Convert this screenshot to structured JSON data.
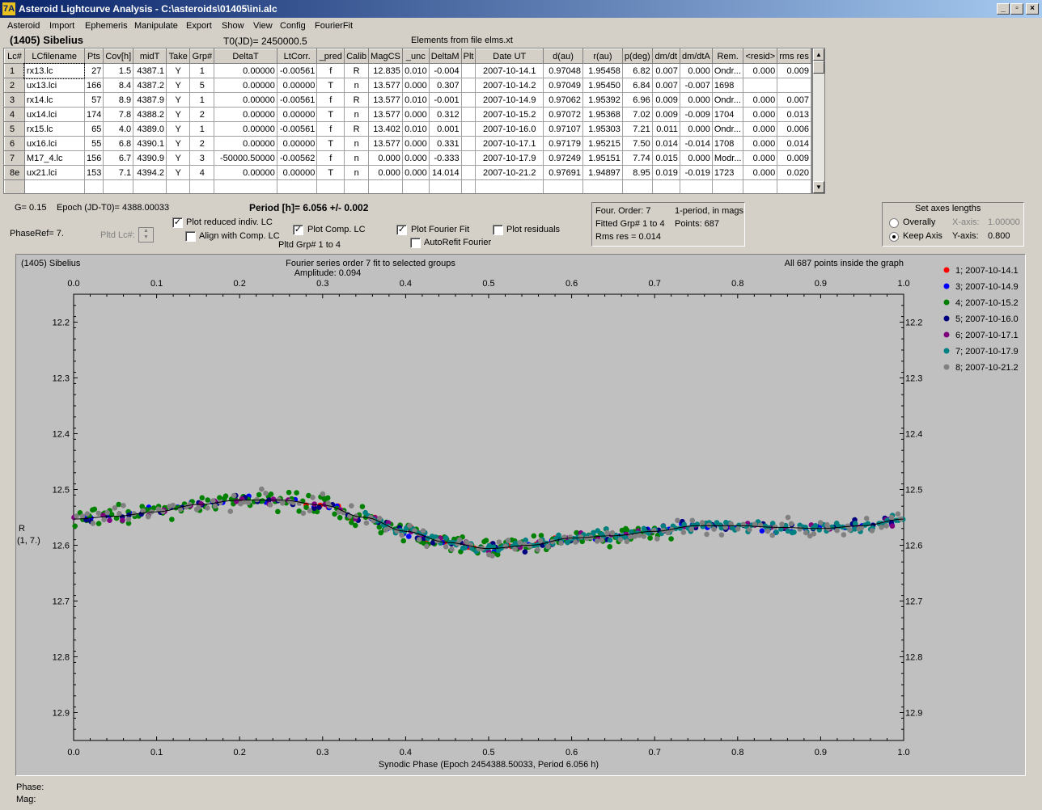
{
  "window": {
    "title": "Asteroid Lightcurve Analysis - C:\\asteroids\\01405\\ini.alc",
    "app_icon": "7A",
    "controls": [
      "_",
      "▫",
      "×"
    ]
  },
  "menu": [
    "Asteroid",
    "Import",
    "Ephemeris",
    "Manipulate",
    "Export",
    "Show",
    "View",
    "Config",
    "FourierFit"
  ],
  "header": {
    "object": "(1405) Sibelius",
    "t0": "T0(JD)= 2450000.5",
    "elements": "Elements from file elms.xt"
  },
  "grid": {
    "columns": [
      "Lc#",
      "LCfilename",
      "Pts",
      "Cov[h]",
      "midT",
      "Take",
      "Grp#",
      "DeltaT",
      "LtCorr.",
      "_pred",
      "Calib",
      "MagCS",
      "_unc",
      "DeltaM",
      "Plt",
      "Date UT",
      "d(au)",
      "r(au)",
      "p(deg)",
      "dm/dt",
      "dm/dtA",
      "Rem.",
      "<resid>",
      "rms res"
    ],
    "rows": [
      [
        "1",
        "rx13.lc",
        "27",
        "1.5",
        "4387.1",
        "Y",
        "1",
        "0.00000",
        "-0.00561",
        "f",
        "R",
        "12.835",
        "0.010",
        "-0.004",
        "",
        "2007-10-14.1",
        "0.97048",
        "1.95458",
        "6.82",
        "0.007",
        "0.000",
        "Ondr...",
        "0.000",
        "0.009"
      ],
      [
        "2",
        "ux13.lci",
        "166",
        "8.4",
        "4387.2",
        "Y",
        "5",
        "0.00000",
        "0.00000",
        "T",
        "n",
        "13.577",
        "0.000",
        "0.307",
        "",
        "2007-10-14.2",
        "0.97049",
        "1.95450",
        "6.84",
        "0.007",
        "-0.007",
        "1698",
        "",
        ""
      ],
      [
        "3",
        "rx14.lc",
        "57",
        "8.9",
        "4387.9",
        "Y",
        "1",
        "0.00000",
        "-0.00561",
        "f",
        "R",
        "13.577",
        "0.010",
        "-0.001",
        "",
        "2007-10-14.9",
        "0.97062",
        "1.95392",
        "6.96",
        "0.009",
        "0.000",
        "Ondr...",
        "0.000",
        "0.007"
      ],
      [
        "4",
        "ux14.lci",
        "174",
        "7.8",
        "4388.2",
        "Y",
        "2",
        "0.00000",
        "0.00000",
        "T",
        "n",
        "13.577",
        "0.000",
        "0.312",
        "",
        "2007-10-15.2",
        "0.97072",
        "1.95368",
        "7.02",
        "0.009",
        "-0.009",
        "1704",
        "0.000",
        "0.013"
      ],
      [
        "5",
        "rx15.lc",
        "65",
        "4.0",
        "4389.0",
        "Y",
        "1",
        "0.00000",
        "-0.00561",
        "f",
        "R",
        "13.402",
        "0.010",
        "0.001",
        "",
        "2007-10-16.0",
        "0.97107",
        "1.95303",
        "7.21",
        "0.011",
        "0.000",
        "Ondr...",
        "0.000",
        "0.006"
      ],
      [
        "6",
        "ux16.lci",
        "55",
        "6.8",
        "4390.1",
        "Y",
        "2",
        "0.00000",
        "0.00000",
        "T",
        "n",
        "13.577",
        "0.000",
        "0.331",
        "",
        "2007-10-17.1",
        "0.97179",
        "1.95215",
        "7.50",
        "0.014",
        "-0.014",
        "1708",
        "0.000",
        "0.014"
      ],
      [
        "7",
        "M17_4.lc",
        "156",
        "6.7",
        "4390.9",
        "Y",
        "3",
        "-50000.50000",
        "-0.00562",
        "f",
        "n",
        "0.000",
        "0.000",
        "-0.333",
        "",
        "2007-10-17.9",
        "0.97249",
        "1.95151",
        "7.74",
        "0.015",
        "0.000",
        "Modr...",
        "0.000",
        "0.009"
      ],
      [
        "8e",
        "ux21.lci",
        "153",
        "7.1",
        "4394.2",
        "Y",
        "4",
        "0.00000",
        "0.00000",
        "T",
        "n",
        "0.000",
        "0.000",
        "14.014",
        "",
        "2007-10-21.2",
        "0.97691",
        "1.94897",
        "8.95",
        "0.019",
        "-0.019",
        "1723",
        "0.000",
        "0.020"
      ]
    ]
  },
  "controls": {
    "g_value": "G= 0.15",
    "epoch": "Epoch (JD-T0)= 4388.00033",
    "period": "Period [h]= 6.056 +/- 0.002",
    "phase_ref": "PhaseRef= 7.",
    "pltd_lc_label": "Pltd Lc#:",
    "plot_reduced": {
      "label": "Plot reduced indiv. LC",
      "checked": true
    },
    "align_comp": {
      "label": "Align with Comp. LC",
      "checked": false
    },
    "plot_comp": {
      "label": "Plot Comp. LC",
      "checked": true
    },
    "pltd_grp": "Pltd Grp#  1   to   4",
    "plot_fourier": {
      "label": "Plot Fourier Fit",
      "checked": true
    },
    "autorefit": {
      "label": "AutoRefit Fourier",
      "checked": false
    },
    "plot_residuals": {
      "label": "Plot residuals",
      "checked": false
    },
    "check_mark": "✓"
  },
  "fourier_info": {
    "order": "Four. Order:  7",
    "mode": "1-period, in mags",
    "fitted": "Fitted Grp# 1 to 4",
    "points": "Points: 687",
    "rms": "Rms res     = 0.014"
  },
  "axes_panel": {
    "title": "Set axes lengths",
    "overally": "Overally",
    "keep_axis": "Keep Axis",
    "x_label": "X-axis:",
    "x_value": "1.00000",
    "y_label": "Y-axis:",
    "y_value": "0.800",
    "selected": "keep_axis"
  },
  "status": {
    "phase": "Phase:",
    "mag": "Mag:"
  },
  "chart_data": {
    "type": "scatter",
    "title": "Fourier series order 7 fit to selected groups",
    "subtitle": "Amplitude: 0.094",
    "corner_left": "(1405) Sibelius",
    "corner_right": "All 687 points inside the graph",
    "xlabel": "Synodic Phase (Epoch 2454388.50033, Period 6.056 h)",
    "ylabel": "R",
    "ylabel2": "(1, 7.)",
    "xlim": [
      0.0,
      1.0
    ],
    "ylim": [
      12.95,
      12.15
    ],
    "y_inverted": true,
    "x_ticks": [
      "0.0",
      "0.1",
      "0.2",
      "0.3",
      "0.4",
      "0.5",
      "0.6",
      "0.7",
      "0.8",
      "0.9",
      "1.0"
    ],
    "y_ticks": [
      "12.2",
      "12.3",
      "12.4",
      "12.5",
      "12.6",
      "12.7",
      "12.8",
      "12.9"
    ],
    "background": "#c0c0c0",
    "series": [
      {
        "name": "1; 2007-10-14.1",
        "color": "#ff0000",
        "range": [
          0.28,
          0.58
        ],
        "count": 27
      },
      {
        "name": "3; 2007-10-14.9",
        "color": "#0000ff",
        "range": [
          0.0,
          1.0
        ],
        "count": 57
      },
      {
        "name": "4; 2007-10-15.2",
        "color": "#008000",
        "range": [
          0.0,
          0.72
        ],
        "count": 174
      },
      {
        "name": "5; 2007-10-16.0",
        "color": "#000080",
        "range": [
          0.0,
          1.0
        ],
        "count": 65
      },
      {
        "name": "6; 2007-10-17.1",
        "color": "#800080",
        "range": [
          0.0,
          1.0
        ],
        "count": 55
      },
      {
        "name": "7; 2007-10-17.9",
        "color": "#008080",
        "range": [
          0.35,
          1.0
        ],
        "count": 156
      },
      {
        "name": "8; 2007-10-21.2",
        "color": "#808080",
        "range": [
          0.0,
          1.0
        ],
        "count": 153
      }
    ],
    "fit_curve": {
      "x": [
        0.0,
        0.05,
        0.1,
        0.15,
        0.2,
        0.25,
        0.3,
        0.35,
        0.4,
        0.45,
        0.5,
        0.55,
        0.6,
        0.65,
        0.7,
        0.75,
        0.8,
        0.85,
        0.9,
        0.95,
        1.0
      ],
      "y": [
        12.553,
        12.548,
        12.54,
        12.527,
        12.519,
        12.519,
        12.528,
        12.55,
        12.575,
        12.595,
        12.606,
        12.6,
        12.587,
        12.583,
        12.575,
        12.565,
        12.565,
        12.568,
        12.57,
        12.565,
        12.553
      ]
    }
  }
}
